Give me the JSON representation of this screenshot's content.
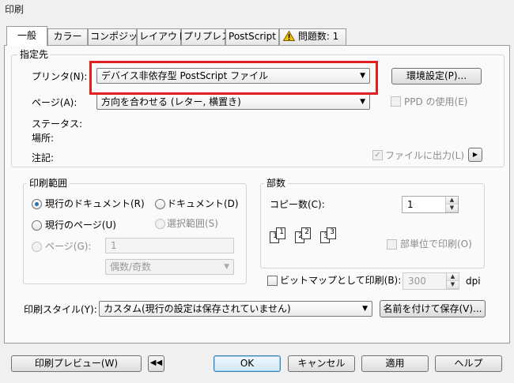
{
  "window": {
    "title": "印刷"
  },
  "tabs": [
    {
      "label": "一般",
      "active": true
    },
    {
      "label": "カラー"
    },
    {
      "label": "コンポジット"
    },
    {
      "label": "レイアウト"
    },
    {
      "label": "プリプレス"
    },
    {
      "label": "PostScript"
    },
    {
      "label": "問題数: 1",
      "icon": "warning-icon"
    }
  ],
  "destination": {
    "title": "指定先",
    "printer_label": "プリンタ(N):",
    "printer_value": "デバイス非依存型 PostScript ファイル",
    "env_button": "環境設定(P)...",
    "page_label": "ページ(A):",
    "page_value": "方向を合わせる (レター, 横置き)",
    "ppd_label": "PPD の使用(E)",
    "status_label": "ステータス:",
    "location_label": "場所:",
    "comment_label": "注記:",
    "print_to_file_label": "ファイルに出力(L)",
    "print_to_file_checked": true
  },
  "range": {
    "title": "印刷範囲",
    "current_doc": "現行のドキュメント(R)",
    "documents": "ドキュメント(D)",
    "current_page": "現行のページ(U)",
    "selection": "選択範囲(S)",
    "pages": "ページ(G):",
    "pages_value": "1",
    "odd_even": "偶数/奇数"
  },
  "copies": {
    "title": "部数",
    "label": "コピー数(C):",
    "value": "1",
    "collate": "部単位で印刷(O)"
  },
  "bitmap": {
    "label": "ビットマップとして印刷(B):",
    "dpi_value": "300",
    "dpi_unit": "dpi"
  },
  "style": {
    "label": "印刷スタイル(Y):",
    "value": "カスタム(現行の設定は保存されていません)",
    "save_button": "名前を付けて保存(V)..."
  },
  "footer": {
    "preview": "印刷プレビュー(W)",
    "ok": "OK",
    "cancel": "キャンセル",
    "apply": "適用",
    "help": "ヘルプ"
  },
  "colors": {
    "highlight": "#e02020",
    "accent": "#3c7fb1",
    "warning": "#f2c200"
  }
}
